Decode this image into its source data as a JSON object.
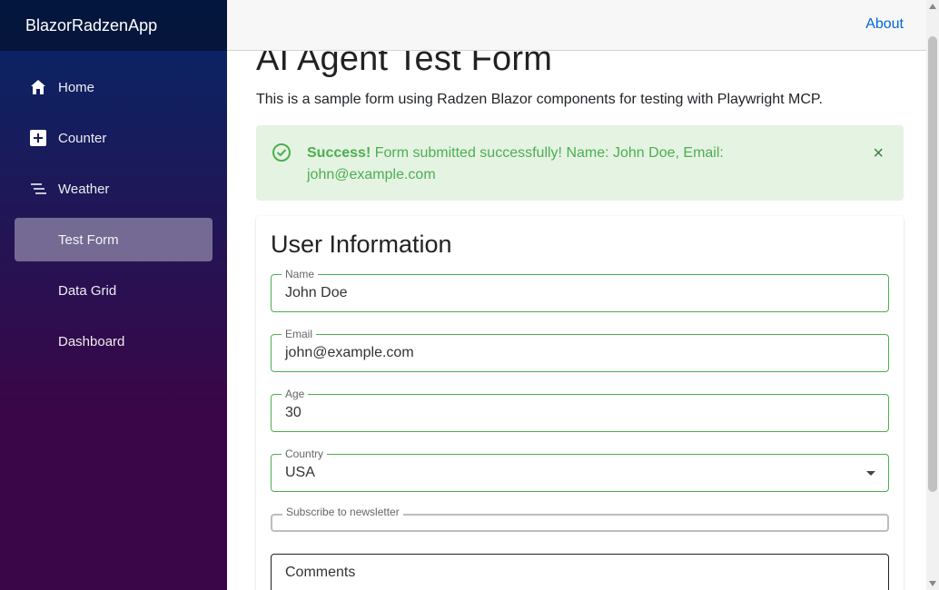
{
  "app": {
    "brand": "BlazorRadzenApp"
  },
  "sidebar": {
    "items": [
      {
        "label": "Home",
        "icon": "home-icon"
      },
      {
        "label": "Counter",
        "icon": "plus-square-icon"
      },
      {
        "label": "Weather",
        "icon": "list-icon"
      },
      {
        "label": "Test Form",
        "icon": ""
      },
      {
        "label": "Data Grid",
        "icon": ""
      },
      {
        "label": "Dashboard",
        "icon": ""
      }
    ],
    "active": "Test Form"
  },
  "topbar": {
    "about": "About"
  },
  "page": {
    "title": "AI Agent Test Form",
    "description": "This is a sample form using Radzen Blazor components for testing with Playwright MCP."
  },
  "alert": {
    "bold": "Success!",
    "message": " Form submitted successfully! Name: John Doe, Email: john@example.com",
    "close": "×",
    "color": "#4caf50"
  },
  "form": {
    "title": "User Information",
    "name_label": "Name",
    "name_value": "John Doe",
    "email_label": "Email",
    "email_value": "john@example.com",
    "age_label": "Age",
    "age_value": "30",
    "country_label": "Country",
    "country_value": "USA",
    "subscribe_label": "Subscribe to newsletter",
    "comments_label": "Comments"
  },
  "colors": {
    "accent": "#4caf50",
    "link": "#0366d6"
  }
}
